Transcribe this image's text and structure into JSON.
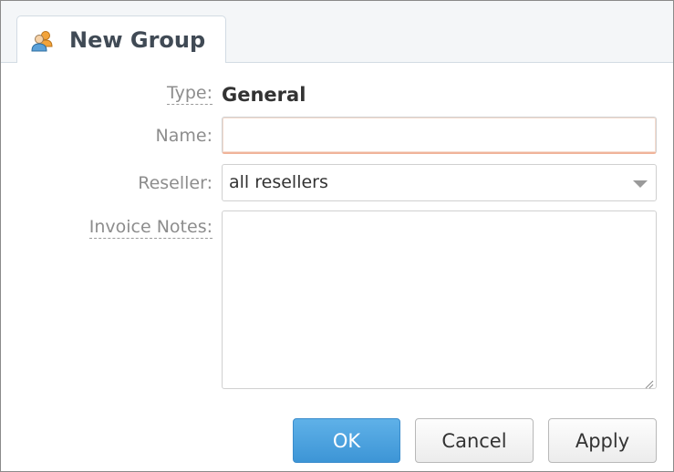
{
  "dialog": {
    "tab_title": "New Group",
    "tab_icon": "user-group-icon"
  },
  "form": {
    "type_label": "Type:",
    "type_value": "General",
    "name_label": "Name:",
    "name_value": "",
    "reseller_label": "Reseller:",
    "reseller_value": "all resellers",
    "invoice_notes_label": "Invoice Notes:",
    "invoice_notes_value": ""
  },
  "buttons": {
    "ok": "OK",
    "cancel": "Cancel",
    "apply": "Apply"
  },
  "colors": {
    "primary_button": "#3d95d6",
    "focus_border": "#f0b49a"
  }
}
